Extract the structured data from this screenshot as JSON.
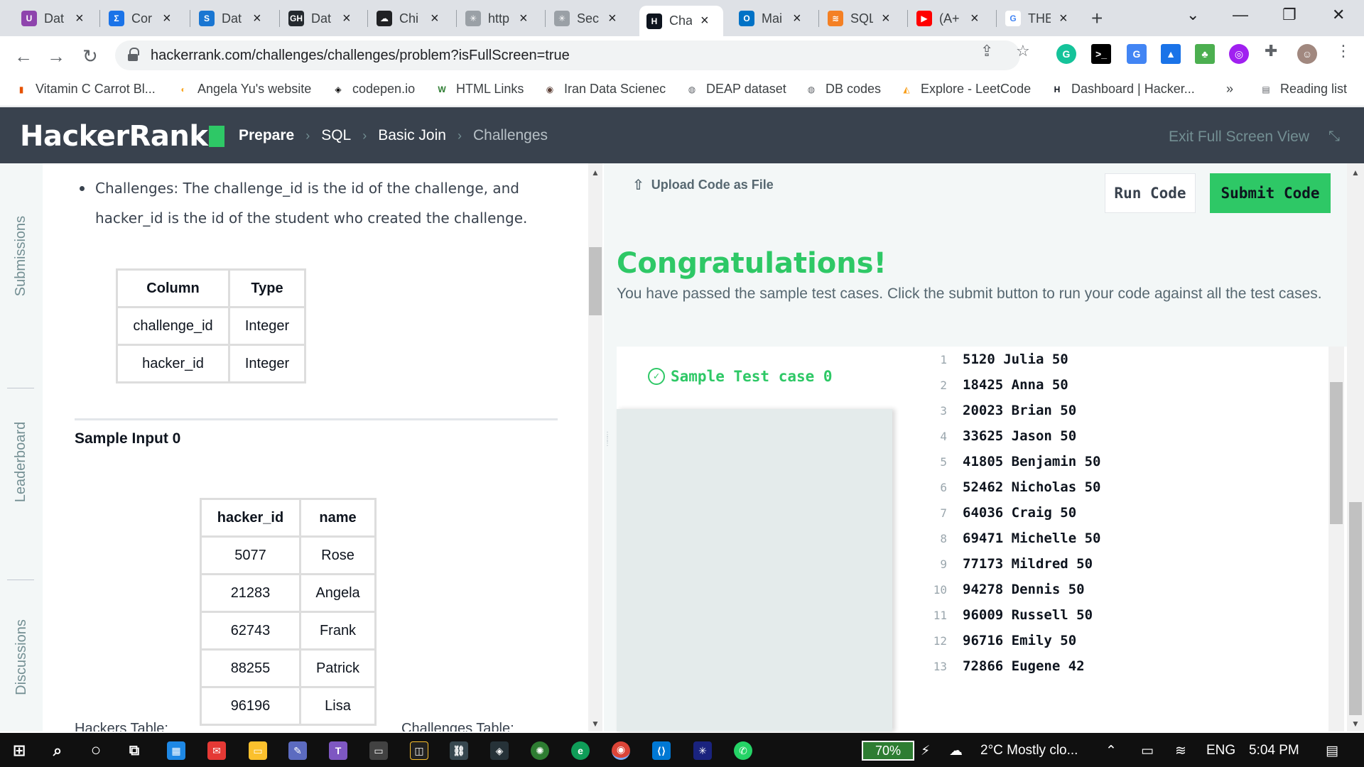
{
  "browser": {
    "tabs": [
      {
        "label": "Dat",
        "icon": "U",
        "color": "#8e44ad"
      },
      {
        "label": "Cor",
        "icon": "Σ",
        "color": "#1a73e8"
      },
      {
        "label": "Dat",
        "icon": "S",
        "color": "#1976d2"
      },
      {
        "label": "Dat",
        "icon": "GH",
        "color": "#24292e"
      },
      {
        "label": "Chi",
        "icon": "☁",
        "color": "#202124"
      },
      {
        "label": "http",
        "icon": "✳",
        "color": "#9aa0a6"
      },
      {
        "label": "Sec",
        "icon": "✳",
        "color": "#9aa0a6"
      },
      {
        "label": "Cha",
        "icon": "H",
        "color": "#0e141e"
      },
      {
        "label": "Mai",
        "icon": "O",
        "color": "#0072c6"
      },
      {
        "label": "SQL",
        "icon": "≋",
        "color": "#f48024"
      },
      {
        "label": "(A+",
        "icon": "▶",
        "color": "#ff0000"
      },
      {
        "label": "THE",
        "icon": "G",
        "color": "#ffffff"
      }
    ],
    "active_tab_index": 7,
    "new_tab": "+",
    "url": "hackerrank.com/challenges/challenges/problem?isFullScreen=true",
    "bookmarks": [
      "Vitamin C Carrot Bl...",
      "Angela Yu's website",
      "codepen.io",
      "HTML Links",
      "Iran Data Scienec",
      "DEAP dataset",
      "DB codes",
      "Explore - LeetCode",
      "Dashboard | Hacker..."
    ],
    "more_bookmarks": "»",
    "reading_list": "Reading list"
  },
  "hr": {
    "logo": "HackerRank",
    "breadcrumbs": [
      "Prepare",
      "SQL",
      "Basic Join",
      "Challenges"
    ],
    "exit_fullscreen": "Exit Full Screen View",
    "side_tabs": [
      "Submissions",
      "Leaderboard",
      "Discussions"
    ]
  },
  "problem": {
    "bullet": "Challenges: The challenge_id is the id of the challenge, and hacker_id is the id of the student who created the challenge.",
    "schema_table": {
      "headers": [
        "Column",
        "Type"
      ],
      "rows": [
        [
          "challenge_id",
          "Integer"
        ],
        [
          "hacker_id",
          "Integer"
        ]
      ]
    },
    "sample_title": "Sample Input 0",
    "hackers_table": {
      "headers": [
        "hacker_id",
        "name"
      ],
      "rows": [
        [
          "5077",
          "Rose"
        ],
        [
          "21283",
          "Angela"
        ],
        [
          "62743",
          "Frank"
        ],
        [
          "88255",
          "Patrick"
        ],
        [
          "96196",
          "Lisa"
        ]
      ]
    },
    "cutoff_left": "Hackers Table:",
    "cutoff_right": "Challenges Table:"
  },
  "editor": {
    "upload": "Upload Code as File",
    "run": "Run Code",
    "submit": "Submit Code",
    "congrats": "Congratulations!",
    "message": "You have passed the sample test cases. Click the submit button to run your code against all the test cases.",
    "test_case": "Sample Test case 0",
    "output": [
      "5120 Julia 50",
      "18425 Anna 50",
      "20023 Brian 50",
      "33625 Jason 50",
      "41805 Benjamin 50",
      "52462 Nicholas 50",
      "64036 Craig 50",
      "69471 Michelle 50",
      "77173 Mildred 50",
      "94278 Dennis 50",
      "96009 Russell 50",
      "96716 Emily 50",
      "72866 Eugene 42"
    ]
  },
  "taskbar": {
    "battery": "70%",
    "weather": "2°C  Mostly clo...",
    "language": "ENG",
    "time": "5:04 PM"
  }
}
